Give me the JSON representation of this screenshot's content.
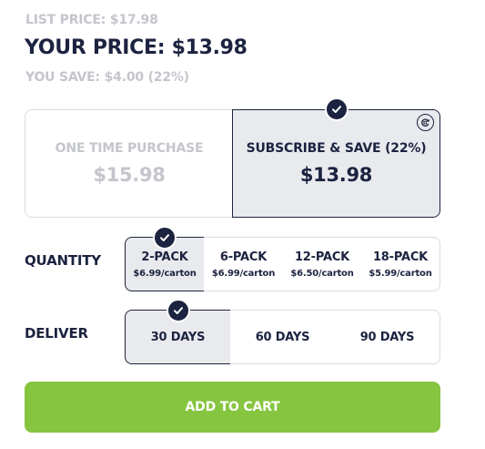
{
  "pricing": {
    "list_price": "LIST PRICE: $17.98",
    "your_price": "YOUR PRICE: $13.98",
    "you_save": "YOU SAVE: $4.00 (22%)"
  },
  "purchase_options": [
    {
      "label": "ONE TIME PURCHASE",
      "price": "$15.98",
      "selected": false
    },
    {
      "label": "SUBSCRIBE & SAVE (22%)",
      "price": "$13.98",
      "selected": true,
      "icon": "recycle-icon"
    }
  ],
  "quantity": {
    "label": "QUANTITY",
    "options": [
      {
        "label": "2-PACK",
        "sub": "$6.99/carton",
        "selected": true
      },
      {
        "label": "6-PACK",
        "sub": "$6.99/carton",
        "selected": false
      },
      {
        "label": "12-PACK",
        "sub": "$6.50/carton",
        "selected": false
      },
      {
        "label": "18-PACK",
        "sub": "$5.99/carton",
        "selected": false
      }
    ]
  },
  "deliver": {
    "label": "DELIVER",
    "options": [
      {
        "label": "30 DAYS",
        "selected": true
      },
      {
        "label": "60 DAYS",
        "selected": false
      },
      {
        "label": "90 DAYS",
        "selected": false
      }
    ]
  },
  "cart_button": "ADD TO CART",
  "colors": {
    "navy": "#1c2340",
    "muted": "#c4c6cc",
    "green": "#86c540",
    "selected_bg": "#e9eaee"
  }
}
